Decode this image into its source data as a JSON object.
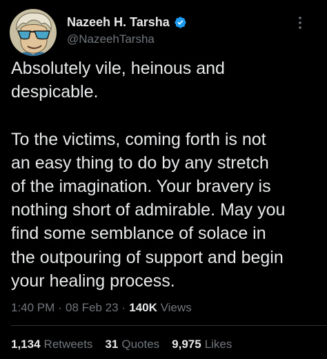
{
  "author": {
    "display_name": "Nazeeh H. Tarsha",
    "handle": "@NazeehTarsha",
    "verified": true,
    "avatar_icon": "cartoon-avatar-icon"
  },
  "tweet": {
    "paragraphs": [
      "Absolutely vile, heinous and\ndespicable.",
      "To the victims, coming forth is not\nan easy thing to do by any stretch\nof the imagination. Your bravery is\nnothing short of admirable. May you\nfind some semblance of solace in\nthe outpouring of support and begin\nyour healing process."
    ]
  },
  "meta": {
    "time": "1:40 PM",
    "separator": "·",
    "date": "08 Feb 23",
    "views_count": "140K",
    "views_label": "Views"
  },
  "stats": {
    "retweets_count": "1,134",
    "retweets_label": "Retweets",
    "quotes_count": "31",
    "quotes_label": "Quotes",
    "likes_count": "9,975",
    "likes_label": "Likes"
  },
  "colors": {
    "background": "#000000",
    "text_primary": "#e7e9ea",
    "text_secondary": "#71767b",
    "verified_blue": "#1d9bf0",
    "divider": "#2f3336"
  }
}
